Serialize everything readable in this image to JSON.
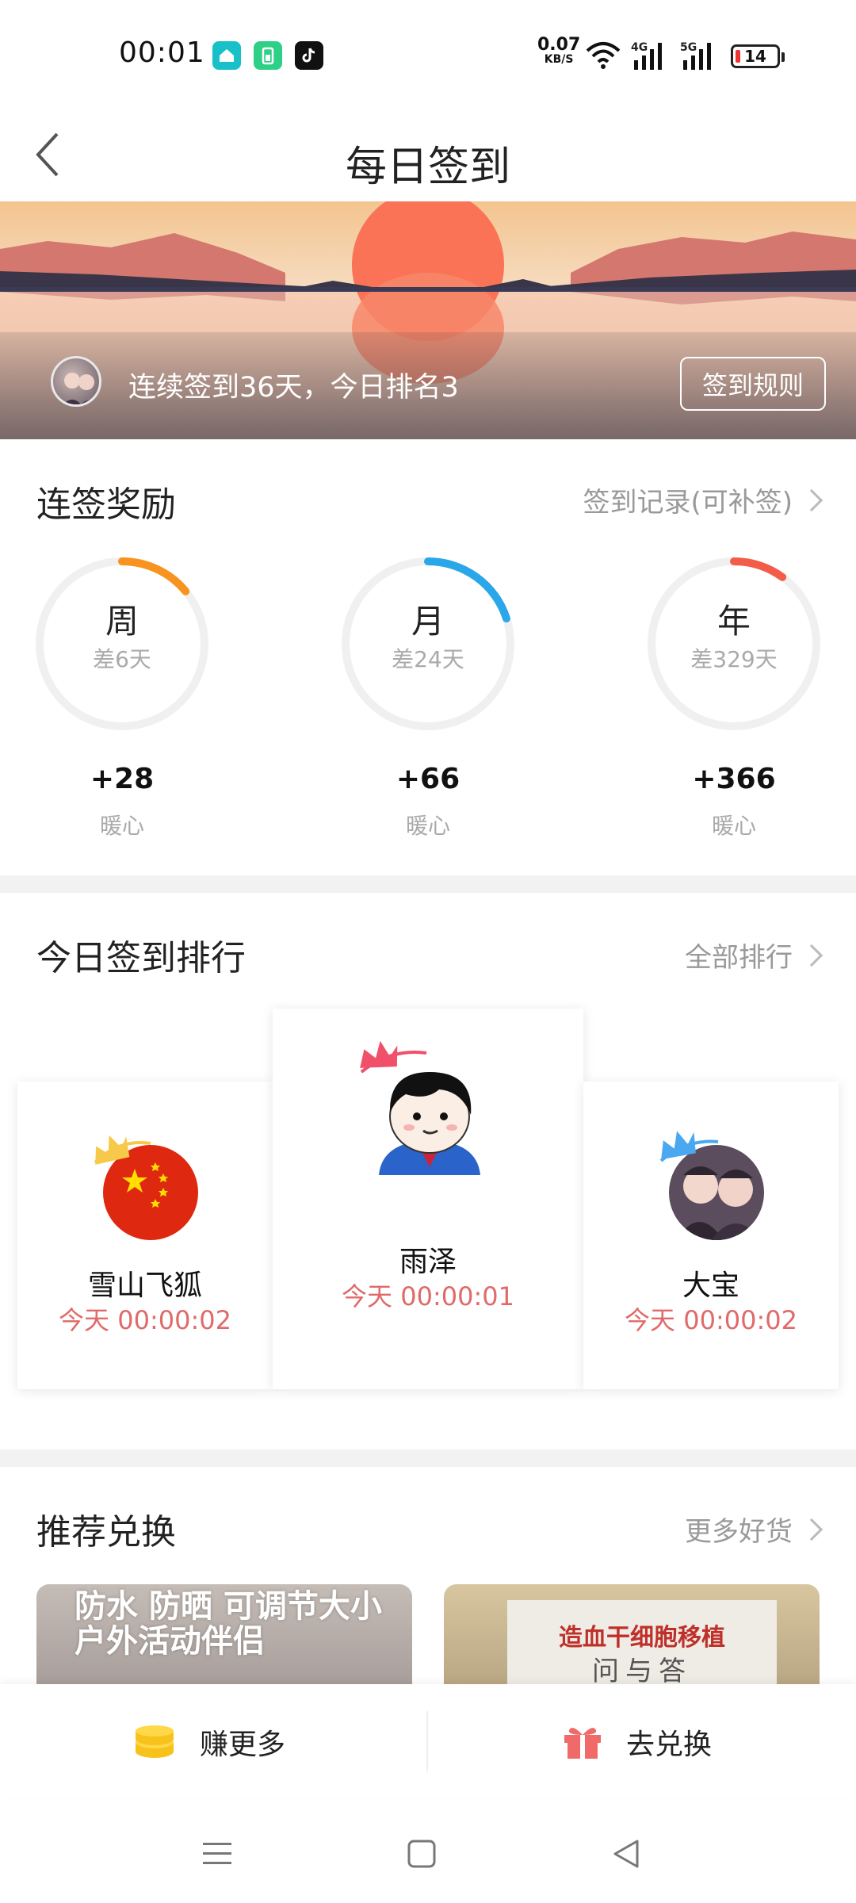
{
  "status_bar": {
    "time": "00:01",
    "net_speed_value": "0.07",
    "net_speed_unit": "KB/S",
    "signal1_label": "4G",
    "signal2_label": "5G",
    "battery_level": "14",
    "app_icons": [
      "home-app-icon",
      "battery-app-icon",
      "tiktok-icon"
    ]
  },
  "header": {
    "title": "每日签到"
  },
  "banner": {
    "streak_text": "连续签到36天，今日排名3",
    "rules_button": "签到规则"
  },
  "streak_rewards": {
    "title": "连签奖励",
    "link": "签到记录(可补签)",
    "rings": [
      {
        "label": "周",
        "sub": "差6天",
        "value": "+28",
        "unit": "暖心",
        "progress": 0.14,
        "color": "#f7931e"
      },
      {
        "label": "月",
        "sub": "差24天",
        "value": "+66",
        "unit": "暖心",
        "progress": 0.2,
        "color": "#2aa7e8"
      },
      {
        "label": "年",
        "sub": "差329天",
        "value": "+366",
        "unit": "暖心",
        "progress": 0.1,
        "color": "#f45c4a"
      }
    ]
  },
  "ranking": {
    "title": "今日签到排行",
    "link": "全部排行",
    "entries": [
      {
        "name": "雪山飞狐",
        "time": "今天 00:00:02"
      },
      {
        "name": "雨泽",
        "time": "今天 00:00:01"
      },
      {
        "name": "大宝",
        "time": "今天 00:00:02"
      }
    ]
  },
  "recommend": {
    "title": "推荐兑换",
    "link": "更多好货",
    "products": [
      {
        "text": "防水 防晒 可调节大小\n户外活动伴侣"
      },
      {
        "line1": "造血干细胞移植",
        "line2": "问与答"
      }
    ]
  },
  "actions": {
    "earn_more": "赚更多",
    "go_exchange": "去兑换"
  },
  "colors": {
    "accent_red": "#e06a6a",
    "ring_track": "#f0f0f0"
  }
}
